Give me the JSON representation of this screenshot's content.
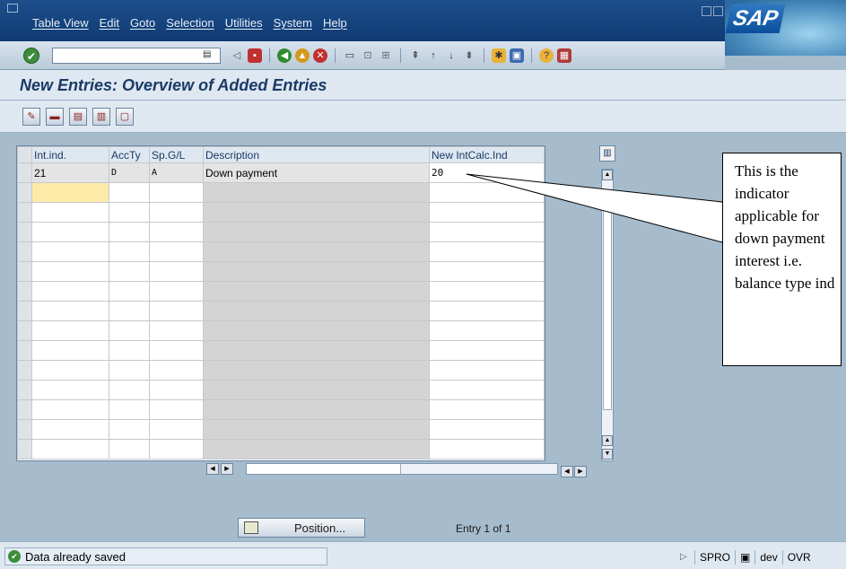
{
  "menubar": {
    "items": [
      "Table View",
      "Edit",
      "Goto",
      "Selection",
      "Utilities",
      "System",
      "Help"
    ]
  },
  "logo": "SAP",
  "screen_title": "New Entries: Overview of Added Entries",
  "table": {
    "headers": [
      "Int.ind.",
      "AccTy",
      "Sp.G/L",
      "Description",
      "New IntCalc.Ind"
    ],
    "rows": [
      [
        "21",
        "D",
        "A",
        "Down payment",
        "20"
      ]
    ],
    "empty_rows": 14
  },
  "callout": "This is the indicator applicable for down payment interest i.e. balance type ind",
  "position_button": "Position...",
  "entry_info": "Entry 1 of 1",
  "status": {
    "message": "Data already saved",
    "system": "SPRO",
    "client": "dev",
    "mode": "OVR"
  },
  "colors": {
    "accent": "#1a3a66",
    "title_bar": "#1d4f8c",
    "background": "#a6bccd"
  }
}
